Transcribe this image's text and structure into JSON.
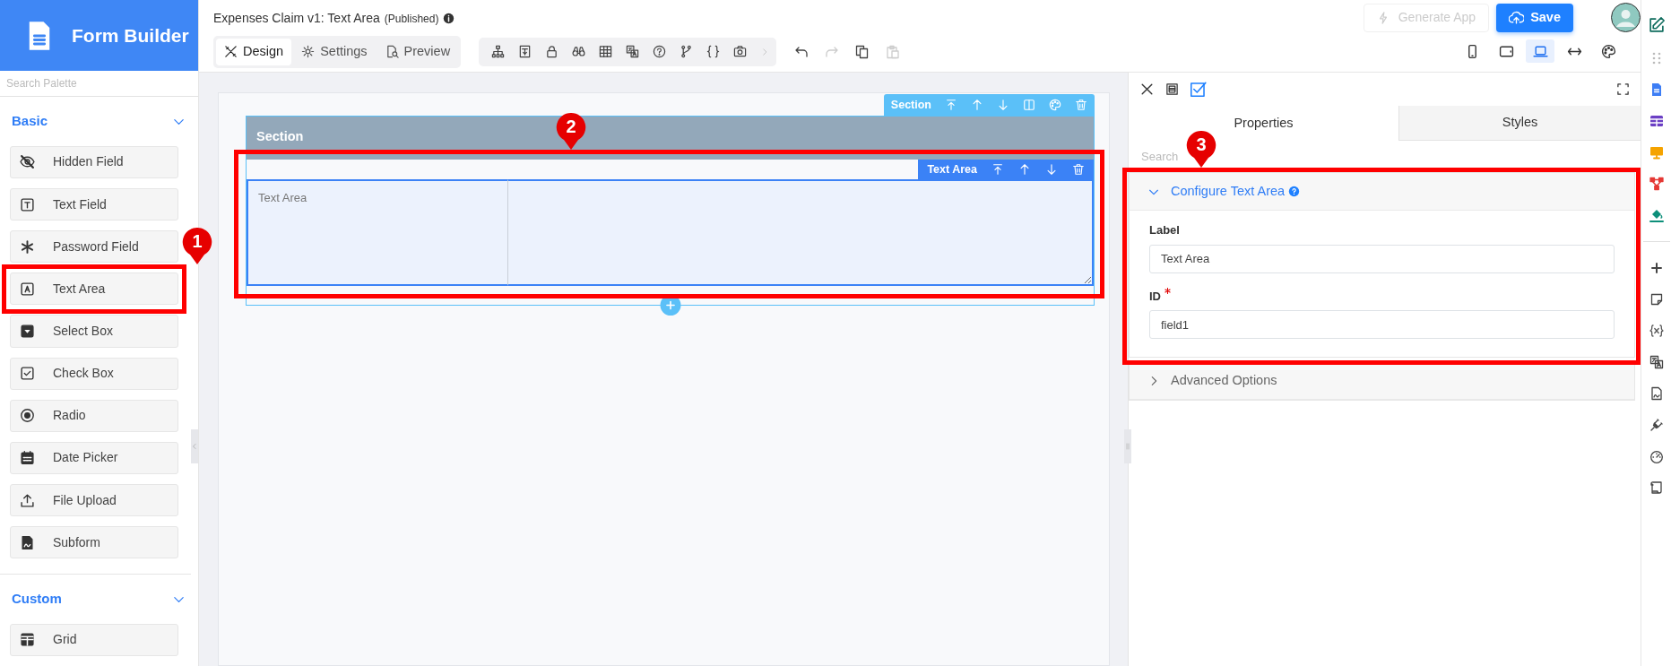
{
  "brand": {
    "title": "Form Builder"
  },
  "form": {
    "title": "Expenses Claim v1: Text Area",
    "status": "(Published)"
  },
  "mode_tabs": [
    {
      "label": "Design",
      "kind": "design",
      "selected": true
    },
    {
      "label": "Settings",
      "kind": "settings",
      "selected": false
    },
    {
      "label": "Preview",
      "kind": "preview",
      "selected": false
    }
  ],
  "edit_actions": [
    {
      "kind": "undo",
      "disabled": false
    },
    {
      "kind": "redo",
      "disabled": true
    },
    {
      "kind": "copy",
      "disabled": false
    },
    {
      "kind": "paste",
      "disabled": true
    }
  ],
  "generate_button": {
    "label": "Generate App",
    "disabled": true
  },
  "save_button": {
    "label": "Save"
  },
  "device_views": [
    {
      "kind": "phone",
      "selected": false
    },
    {
      "kind": "tablet",
      "selected": false
    },
    {
      "kind": "laptop",
      "selected": true
    },
    {
      "kind": "full-width",
      "selected": false
    }
  ],
  "palette": {
    "search_placeholder": "Search Palette",
    "groups": [
      {
        "title": "Basic",
        "expanded": true,
        "items": [
          {
            "label": "Hidden Field",
            "kind": "hidden"
          },
          {
            "label": "Text Field",
            "kind": "text"
          },
          {
            "label": "Password Field",
            "kind": "password"
          },
          {
            "label": "Text Area",
            "kind": "textarea",
            "callout": "1"
          },
          {
            "label": "Select Box",
            "kind": "select"
          },
          {
            "label": "Check Box",
            "kind": "checkbox"
          },
          {
            "label": "Radio",
            "kind": "radio"
          },
          {
            "label": "Date Picker",
            "kind": "date"
          },
          {
            "label": "File Upload",
            "kind": "upload"
          },
          {
            "label": "Subform",
            "kind": "subform"
          }
        ]
      },
      {
        "title": "Custom",
        "expanded": true,
        "items": [
          {
            "label": "Grid",
            "kind": "grid"
          }
        ]
      }
    ]
  },
  "canvas": {
    "section": {
      "title": "Section",
      "toolbar_label": "Section",
      "field": {
        "toolbar_label": "Text Area",
        "label": "Text Area",
        "callout": "2"
      }
    }
  },
  "properties": {
    "tabs": [
      {
        "label": "Properties",
        "selected": true
      },
      {
        "label": "Styles",
        "selected": false
      }
    ],
    "search_placeholder": "Search",
    "panels": [
      {
        "title": "Configure Text Area",
        "expanded": true,
        "callout": "3",
        "fields": [
          {
            "label": "Label",
            "value": "Text Area",
            "required": false
          },
          {
            "label": "ID",
            "value": "field1",
            "required": true
          }
        ]
      },
      {
        "title": "Advanced Options",
        "expanded": false
      }
    ]
  }
}
